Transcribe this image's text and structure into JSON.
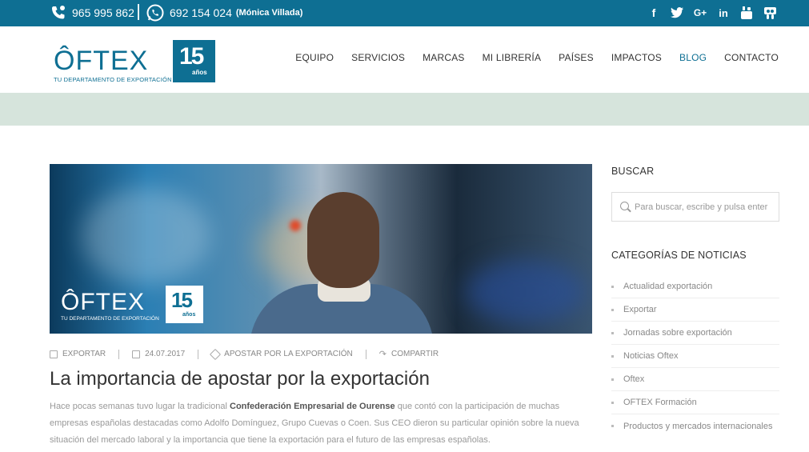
{
  "topbar": {
    "phone": "965 995 862",
    "whatsapp": "692 154 024",
    "contact_name": "(Mónica Villada)",
    "socials": [
      "facebook-icon",
      "twitter-icon",
      "google-plus-icon",
      "linkedin-icon",
      "youtube-icon",
      "slideshare-icon"
    ],
    "social_glyphs": [
      "f",
      "t",
      "G+",
      "in",
      "▶",
      "S"
    ]
  },
  "brand": {
    "logo": "ÔFTEX",
    "tagline": "TU DEPARTAMENTO DE EXPORTACIÓN",
    "badge_number": "15",
    "badge_sub": "años"
  },
  "nav": [
    {
      "label": "EQUIPO",
      "active": false
    },
    {
      "label": "SERVICIOS",
      "active": false
    },
    {
      "label": "MARCAS",
      "active": false
    },
    {
      "label": "MI LIBRERÍA",
      "active": false
    },
    {
      "label": "PAÍSES",
      "active": false
    },
    {
      "label": "IMPACTOS",
      "active": false
    },
    {
      "label": "BLOG",
      "active": true
    },
    {
      "label": "CONTACTO",
      "active": false
    }
  ],
  "post": {
    "category": "EXPORTAR",
    "date": "24.07.2017",
    "tag": "APOSTAR POR LA EXPORTACIÓN",
    "share": "COMPARTIR",
    "title": "La importancia de apostar por la exportación",
    "excerpt_before": "Hace pocas semanas tuvo lugar la tradicional ",
    "excerpt_bold": "Confederación Empresarial de Ourense",
    "excerpt_after": " que contó con la participación de muchas empresas españolas destacadas como Adolfo Domínguez, Grupo Cuevas o Coen. Sus CEO dieron su particular opinión sobre la nueva situación del mercado laboral y la importancia que tiene la exportación para el futuro de las empresas españolas."
  },
  "sidebar": {
    "search_heading": "BUSCAR",
    "search_placeholder": "Para buscar, escribe y pulsa enter",
    "categories_heading": "CATEGORÍAS DE NOTICIAS",
    "categories": [
      "Actualidad exportación",
      "Exportar",
      "Jornadas sobre exportación",
      "Noticias Oftex",
      "Oftex",
      "OFTEX Formación",
      "Productos y mercados internacionales"
    ]
  },
  "colors": {
    "brand": "#0e6f93",
    "band": "#d6e4dc"
  }
}
